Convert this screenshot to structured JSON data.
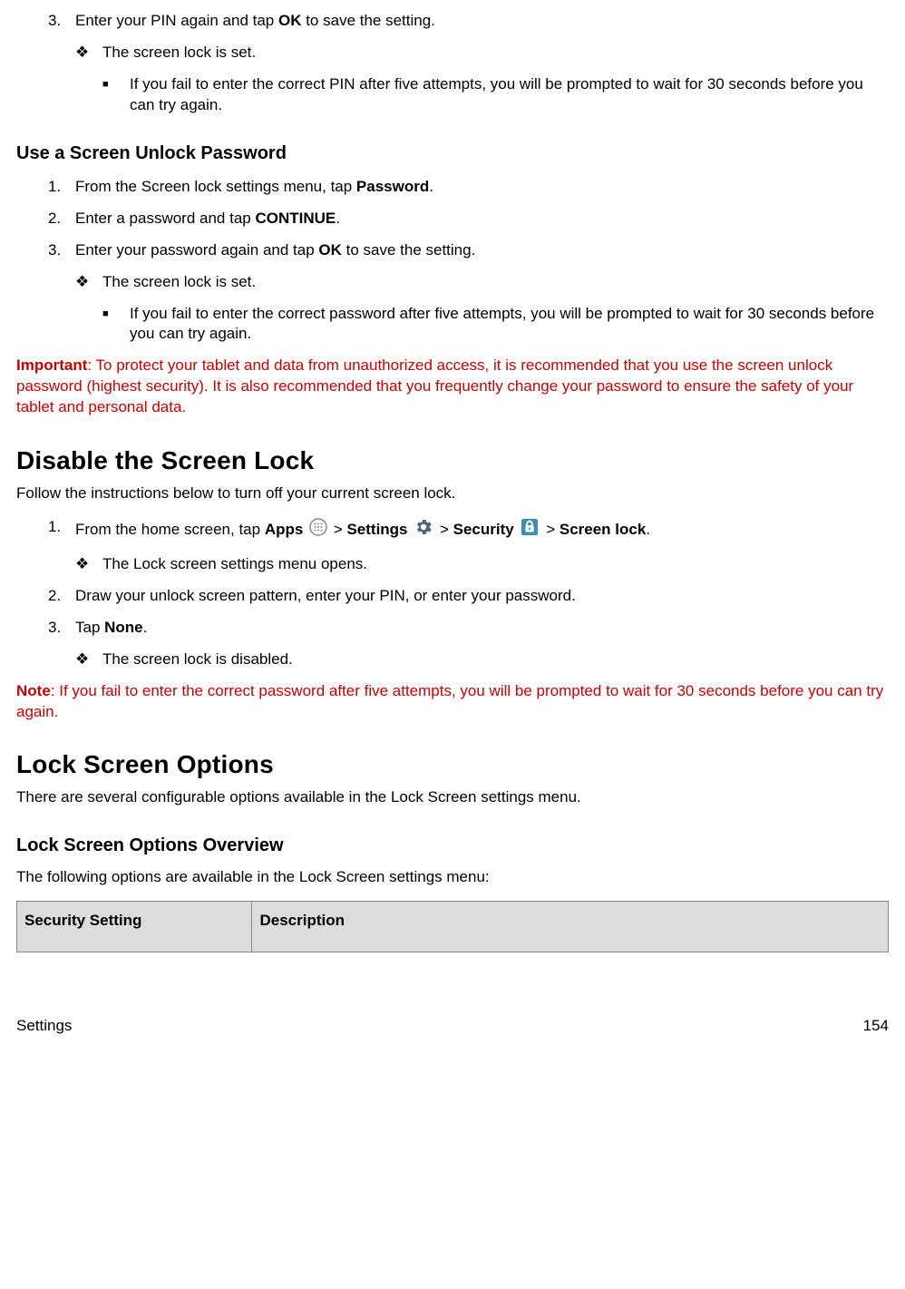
{
  "pin_section": {
    "step3_num": "3.",
    "step3_a": "Enter your PIN again and tap ",
    "step3_b": "OK",
    "step3_c": " to save the setting.",
    "result": "The screen lock is set.",
    "fail": "If you fail to enter the correct PIN after five attempts, you will be prompted to wait for 30 seconds before you can try again."
  },
  "password_section": {
    "heading": "Use a Screen Unlock Password",
    "s1_num": "1.",
    "s1_a": "From the Screen lock settings menu, tap ",
    "s1_b": "Password",
    "s1_c": ".",
    "s2_num": "2.",
    "s2_a": "Enter a password and tap ",
    "s2_b": "CONTINUE",
    "s2_c": ".",
    "s3_num": "3.",
    "s3_a": "Enter your password again and tap ",
    "s3_b": "OK",
    "s3_c": " to save the setting.",
    "result": "The screen lock is set.",
    "fail": "If you fail to enter the correct password after five attempts, you will be prompted to wait for 30 seconds before you can try again."
  },
  "important": {
    "label": "Important",
    "text": ": To protect your tablet and data from unauthorized access, it is recommended that you use the screen unlock password (highest security). It is also recommended that you frequently change your password to ensure the safety of your tablet and personal data."
  },
  "disable_section": {
    "heading": "Disable the Screen Lock",
    "intro": "Follow the instructions below to turn off your current screen lock.",
    "s1_num": "1.",
    "s1_a": "From the home screen, tap ",
    "s1_b": "Apps",
    "s1_c": " > ",
    "s1_d": "Settings",
    "s1_e": " > ",
    "s1_f": "Security",
    "s1_g": " > ",
    "s1_h": "Screen lock",
    "s1_i": ".",
    "result1": "The Lock screen settings menu opens.",
    "s2_num": "2.",
    "s2_text": "Draw your unlock screen pattern, enter your PIN, or enter your password.",
    "s3_num": "3.",
    "s3_a": "Tap ",
    "s3_b": "None",
    "s3_c": ".",
    "result3": "The screen lock is disabled."
  },
  "note": {
    "label": "Note",
    "text": ": If you fail to enter the correct password after five attempts, you will be prompted to wait for 30 seconds before you can try again."
  },
  "options_section": {
    "heading": "Lock Screen Options",
    "intro": "There are several configurable options available in the Lock Screen settings menu.",
    "subheading": "Lock Screen Options Overview",
    "lead": "The following options are available in the Lock Screen settings menu:",
    "col1": "Security Setting",
    "col2": "Description"
  },
  "footer": {
    "left": "Settings",
    "right": "154"
  },
  "bullets": {
    "diamond": "❖",
    "square": "■"
  }
}
